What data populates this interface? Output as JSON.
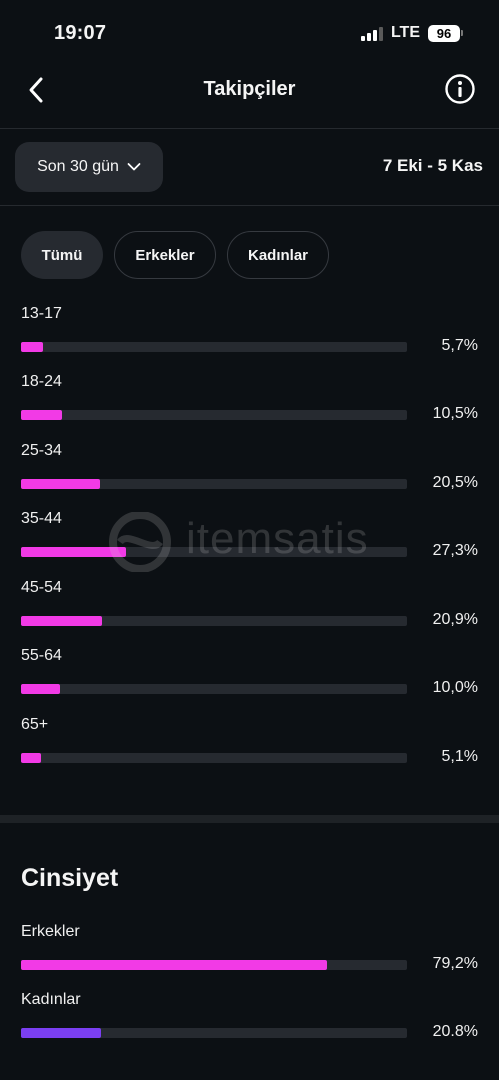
{
  "status_bar": {
    "time": "19:07",
    "network": "LTE",
    "battery": "96"
  },
  "header": {
    "title": "Takipçiler",
    "back_icon": "chevron-left-icon",
    "info_icon": "info-icon"
  },
  "filter": {
    "range_label": "Son 30 gün",
    "date_range": "7 Eki - 5 Kas"
  },
  "tabs": [
    {
      "label": "Tümü",
      "active": true
    },
    {
      "label": "Erkekler",
      "active": false
    },
    {
      "label": "Kadınlar",
      "active": false
    }
  ],
  "age_groups": [
    {
      "label": "13-17",
      "value": "5,7%",
      "percent": 5.7
    },
    {
      "label": "18-24",
      "value": "10,5%",
      "percent": 10.5
    },
    {
      "label": "25-34",
      "value": "20,5%",
      "percent": 20.5
    },
    {
      "label": "35-44",
      "value": "27,3%",
      "percent": 27.3
    },
    {
      "label": "45-54",
      "value": "20,9%",
      "percent": 20.9
    },
    {
      "label": "55-64",
      "value": "10,0%",
      "percent": 10.0
    },
    {
      "label": "65+",
      "value": "5,1%",
      "percent": 5.1
    }
  ],
  "gender": {
    "title": "Cinsiyet",
    "items": [
      {
        "label": "Erkekler",
        "value": "79,2%",
        "percent": 79.2,
        "color": "#f23ae6"
      },
      {
        "label": "Kadınlar",
        "value": "20.8%",
        "percent": 20.8,
        "color": "#7b3ff2"
      }
    ]
  },
  "watermark": {
    "text": "itemsatis"
  },
  "colors": {
    "background": "#0c1014",
    "bar_primary": "#f23ae6",
    "bar_secondary": "#7b3ff2",
    "track": "#262a30"
  }
}
